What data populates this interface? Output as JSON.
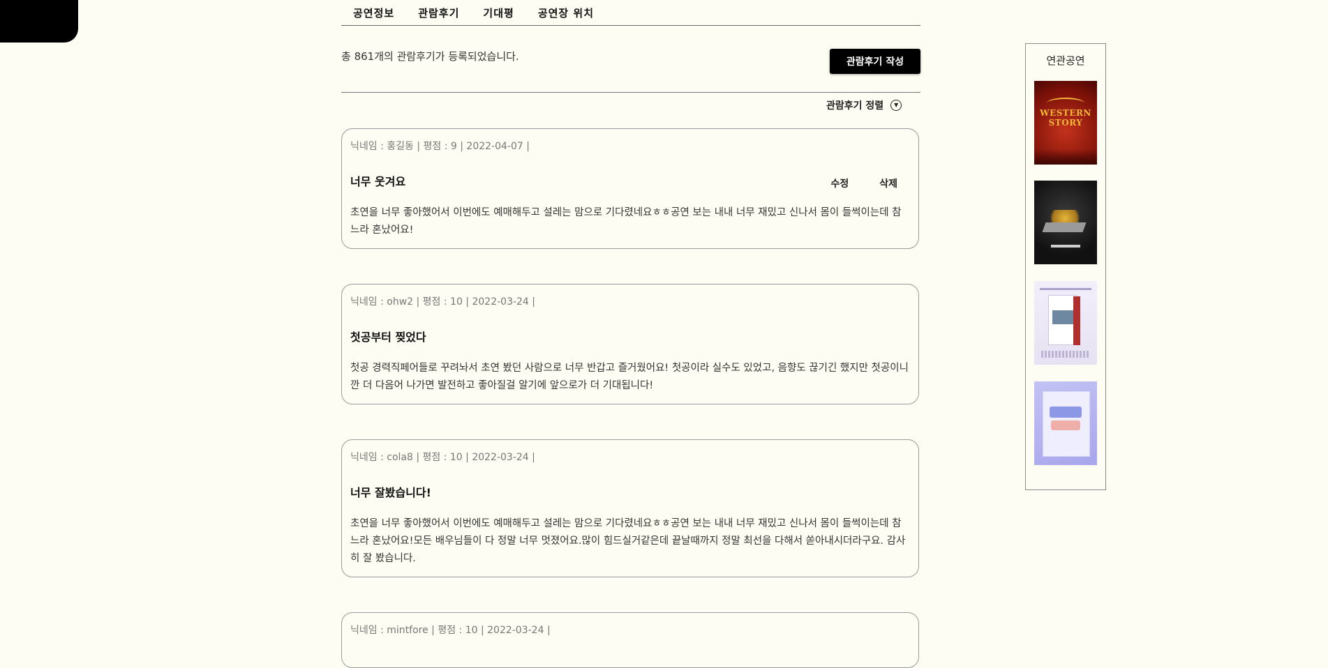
{
  "tabs": [
    "공연정보",
    "관람후기",
    "기대평",
    "공연장 위치"
  ],
  "summary": {
    "count_text": "총 861개의 관람후기가 등록되었습니다.",
    "write_button": "관람후기 작성"
  },
  "sort": {
    "label": "관람후기 정렬"
  },
  "reviews": [
    {
      "meta": "닉네임 : 홍길동 | 평점 : 9 | 2022-04-07 |",
      "title": "너무 웃겨요",
      "body": "초연을 너무 좋아했어서 이번에도 예매해두고 설레는 맘으로 기다렸네요ㅎㅎ공연 보는 내내 너무 재밌고 신나서 몸이 들썩이는데 참느라 혼났어요!",
      "edit_label": "수정",
      "delete_label": "삭제"
    },
    {
      "meta": "닉네임 : ohw2 | 평점 : 10 | 2022-03-24 |",
      "title": "첫공부터 찢었다",
      "body": "첫공 경력직페어들로 꾸려놔서 초연 봤던 사람으로 너무 반갑고 즐거웠어요! 첫공이라 실수도 있었고, 음향도 끊기긴 했지만 첫공이니깐 더 다음어 나가면 발전하고 좋아질걸 알기에 앞으로가 더 기대됩니다!"
    },
    {
      "meta": "닉네임 : cola8 | 평점 : 10 | 2022-03-24 |",
      "title": "너무 잘봤습니다!",
      "body": "초연을 너무 좋아했어서 이번에도 예매해두고 설레는 맘으로 기다렸네요ㅎㅎ공연 보는 내내 너무 재밌고 신나서 몸이 들썩이는데 참느라 혼났어요!모든 배우님들이 다 정말 너무 멋졌어요.많이 힘드실거같은데 끝날때까지 정말 최선을 다해서 쏟아내시더라구요. 감사히 잘 봤습니다."
    },
    {
      "meta": "닉네임 : mintfore | 평점 : 10 | 2022-03-24 |"
    }
  ],
  "related": {
    "title": "연관공연",
    "posters": [
      {
        "line1": "WESTERN",
        "line2": "STORY",
        "accent": "#f5b83a"
      },
      {
        "line1": "",
        "line2": "",
        "accent": "#e8b53a"
      },
      {
        "line1": "",
        "line2": "",
        "accent": "#b03030"
      },
      {
        "line1": "",
        "line2": "",
        "accent": "#e88a90"
      }
    ]
  }
}
